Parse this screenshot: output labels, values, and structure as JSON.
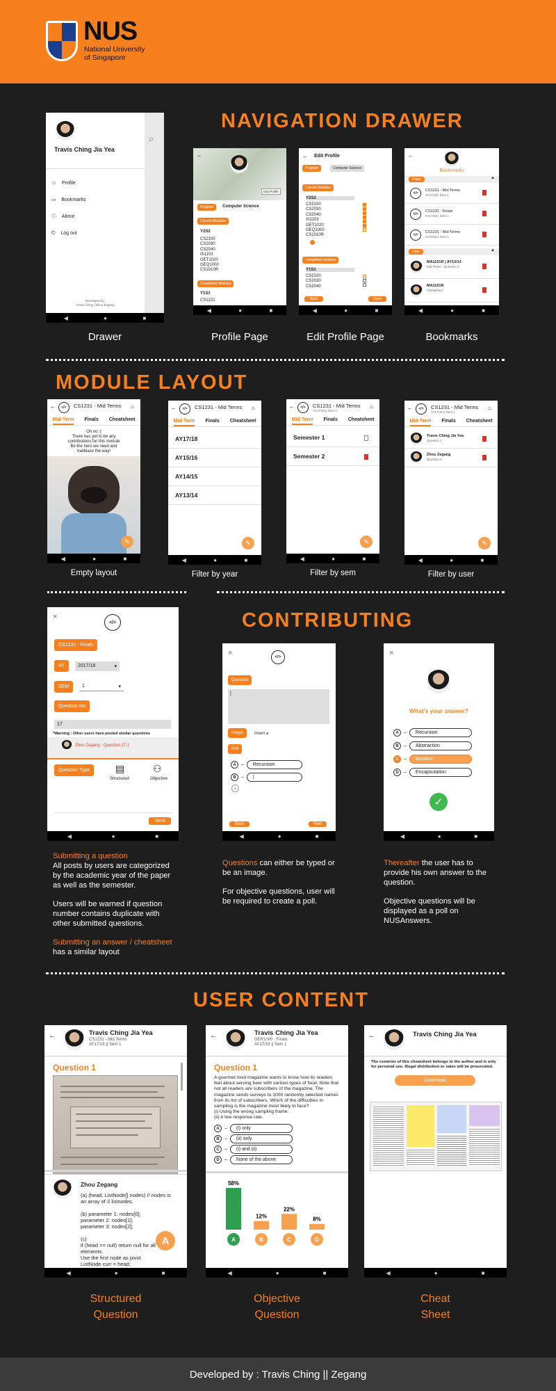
{
  "header": {
    "logo_text": "NUS",
    "logo_sub1": "National University",
    "logo_sub2": "of Singapore"
  },
  "sections": {
    "nav_drawer": "NAVIGATION DRAWER",
    "module_layout": "MODULE LAYOUT",
    "contributing": "CONTRIBUTING",
    "user_content": "USER CONTENT"
  },
  "drawer": {
    "caption": "Drawer",
    "user_name": "Travis Ching Jia Yea",
    "items": [
      "Profile",
      "Bookmarks",
      "About",
      "Log out"
    ],
    "credit1": "Developed by",
    "credit2": "Travis Ching | Zhou Zegang"
  },
  "profile": {
    "caption": "Profile Page",
    "program_label": "Program",
    "program_value": "Computer Science",
    "current_label": "Current Modules",
    "sem": "Y2S2",
    "modules": [
      "CS2100",
      "CS2030",
      "CS2040",
      "IS1103",
      "GET1020",
      "GEQ1000",
      "CS1010R"
    ],
    "completed_label": "Completed Modules",
    "sem2": "Y1S1",
    "completed": [
      "CS1231"
    ],
    "edit_btn": "Edit Profile"
  },
  "edit_profile": {
    "caption": "Edit Profile Page",
    "title": "Edit Profile",
    "program_label": "Program",
    "program_value": "Computer Science",
    "current_label": "Current Modules",
    "sem": "Y2S2",
    "modules": [
      "CS2100",
      "CS2030",
      "CS2040",
      "IS1103",
      "GET1020",
      "GEQ1000",
      "CS1010R"
    ],
    "completed_label": "Completed Modules",
    "sem2": "Y1S1",
    "completed": [
      "CS2100",
      "CS2030",
      "CS2040"
    ],
    "back": "Back",
    "done": "Done"
  },
  "bookmarks": {
    "caption": "Bookmarks",
    "title": "Bookmarks",
    "paper_label": "Paper",
    "papers": [
      {
        "t": "CS1231 - Mid Terms",
        "s": "AY17/18 | Sem 1"
      },
      {
        "t": "CS1231 - Finals",
        "s": "AY17/18 | Sem 1"
      },
      {
        "t": "CS1231 - Mid Terms",
        "s": "AY15/16 | Sem 2"
      }
    ],
    "user_label": "User",
    "users": [
      {
        "t": "MA1101R | AY13/14",
        "s": "Mid Terms - Question 3"
      },
      {
        "t": "MA1101R",
        "s": "Cheatsheet"
      }
    ]
  },
  "module_common": {
    "title": "CS1231 - Mid Terms",
    "sub": "AY17/18 || Sem 1",
    "tabs": [
      "Mid-Term",
      "Finals",
      "Cheatsheet"
    ]
  },
  "empty_layout": {
    "caption": "Empty layout",
    "msg": [
      "Oh no :(",
      "There has yet to be any",
      "contributions for this module",
      "Be the hero we need and",
      "trailblaze the way!"
    ]
  },
  "filter_year": {
    "caption": "Filter by year",
    "years": [
      "AY17/18",
      "AY15/16",
      "AY14/15",
      "AY13/14"
    ]
  },
  "filter_sem": {
    "caption": "Filter by sem",
    "sems": [
      "Semester 1",
      "Semester 2"
    ]
  },
  "filter_user": {
    "caption": "Filter by user",
    "users": [
      {
        "t": "Travis Ching Jia Yea",
        "s": "Question 1"
      },
      {
        "t": "Zhou Zegang",
        "s": "Question 2"
      }
    ]
  },
  "submit_q": {
    "title_btn": "CS1231 - Finals",
    "ay_label": "AY",
    "ay_value": "2017/18",
    "sem_label": "SEM",
    "sem_value": "1",
    "qno_label": "Question No",
    "qno_value": "17",
    "warning": "*Warning : Other users have posted similar questions",
    "similar": "Zhou Zegang - Question 17.1",
    "qtype_label": "Question Type",
    "types": [
      "Structured",
      "Objective"
    ],
    "next": "Next"
  },
  "question_input": {
    "question_label": "Question",
    "image_label": "Image",
    "insert": "Insert",
    "poll_label": "Poll",
    "opt_a": "Recursion",
    "back": "Back",
    "next": "Next"
  },
  "answer_page": {
    "prompt": "What's your answer?",
    "options": [
      "Recursion",
      "Abstraction",
      "Iterative",
      "Encapsulation"
    ]
  },
  "contrib_text": {
    "col1": {
      "h1": "Submitting a question",
      "p1": "All posts by users are categorized by the academic year of the paper as well as the semester.",
      "p2": "Users will be warned if question number contains duplicate with other submitted questions.",
      "h2": "Submitting an answer / cheatsheet",
      "p3": "has a similar layout"
    },
    "col2": {
      "h": "Questions",
      "p1": " can either be typed or be an image.",
      "p2": "For objective questions, user will be required to create a poll."
    },
    "col3": {
      "h": "Thereafter",
      "p1": " the user has to provide his own answer to the question.",
      "p2": "Objective questions will be displayed as a poll on NUSAnswers."
    }
  },
  "user_content": {
    "name": "Travis Ching Jia Yea",
    "sub1": "CS1231 - Mid Terms",
    "sub2": "AY17/18 || Sem 1",
    "sub3": "GER1000 - Finals",
    "structured": {
      "caption1": "Structured",
      "caption2": "Question",
      "q": "Question 1",
      "answerer": "Zhou Zegang",
      "answer": [
        "(a) (head, ListNode[] nodes) // nodes is",
        "an array of 3 listnodes.",
        "",
        "(b) parameter 1: nodes[0];",
        "parameter 2: nodes[1];",
        "parameter 3: nodes[2];",
        "",
        "(c)",
        "if (head == null) return null for all",
        "elements.",
        "Use the first node as pivot",
        "ListNode curr = head;"
      ],
      "fab": "A"
    },
    "objective": {
      "caption1": "Objective",
      "caption2": "Question",
      "q": "Question 1",
      "text": "A gourmet food magazine wants to know how its readers feel about serving beer with various types of food. Note that not all readers are subscribers of the magazine. The magazine sends surveys to 1000 randomly selected names from its list of subscribers. Which of the difficulties in sampling is the magazine most likely to face?",
      "text2": "(i) Using the wrong sampling frame.",
      "text3": "(ii) A low response rate.",
      "options": [
        {
          "l": "A",
          "t": "(i) only"
        },
        {
          "l": "B",
          "t": "(ii) only"
        },
        {
          "l": "C",
          "t": "(i) and (ii)"
        },
        {
          "l": "D",
          "t": "None of the above"
        }
      ]
    },
    "cheat": {
      "caption1": "Cheat",
      "caption2": "Sheet",
      "notice": "The contents of this cheatsheet belongs to the author and is only for personal use. Illegal distribution or sales will be prosecuted.",
      "download": "Download"
    }
  },
  "chart_data": {
    "type": "bar",
    "categories": [
      "A",
      "B",
      "C",
      "D"
    ],
    "values": [
      58,
      12,
      22,
      8
    ],
    "labels": [
      "58%",
      "12%",
      "22%",
      "8%"
    ],
    "colors": [
      "#2e9e4f",
      "#f7a04e",
      "#f7a04e",
      "#f7a04e"
    ],
    "ylim": [
      0,
      60
    ]
  },
  "footer": {
    "text": "Developed by : Travis Ching || Zegang"
  },
  "colors": {
    "accent": "#f7801e",
    "bg": "#1e1e1e",
    "green": "#2e9e4f"
  }
}
